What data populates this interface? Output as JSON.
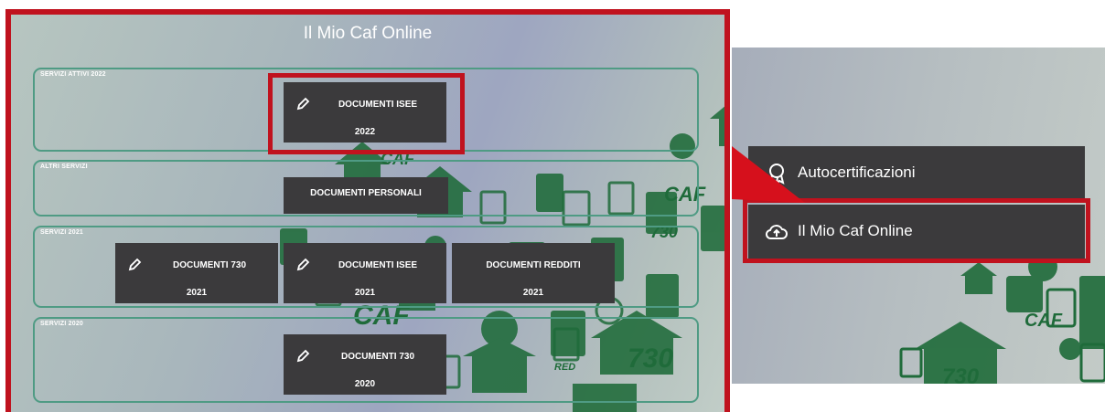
{
  "panel_title": "Il Mio Caf Online",
  "sections": [
    {
      "label": "SERVIZI ATTIVI 2022"
    },
    {
      "label": "ALTRI SERVIZI"
    },
    {
      "label": "SERVIZI 2021"
    },
    {
      "label": "SERVIZI 2020"
    }
  ],
  "buttons": {
    "isee_2022": {
      "title": "DOCUMENTI ISEE",
      "year": "2022"
    },
    "personali": {
      "title": "DOCUMENTI PERSONALI"
    },
    "730_2021": {
      "title": "DOCUMENTI 730",
      "year": "2021"
    },
    "isee_2021": {
      "title": "DOCUMENTI ISEE",
      "year": "2021"
    },
    "redditi_2021": {
      "title": "DOCUMENTI REDDITI",
      "year": "2021"
    },
    "730_2020": {
      "title": "DOCUMENTI 730",
      "year": "2020"
    }
  },
  "menu": [
    {
      "label": "Autocertificazioni",
      "icon": "award-icon"
    },
    {
      "label": "Il Mio Caf Online",
      "icon": "cloud-upload-icon"
    }
  ],
  "background_watermark": [
    "CAF",
    "730",
    "RED"
  ],
  "colors": {
    "highlight": "#c0121e",
    "section_border": "#4f9b84",
    "button_bg": "#3b3a3c",
    "icon_green": "#1f6b3a"
  }
}
